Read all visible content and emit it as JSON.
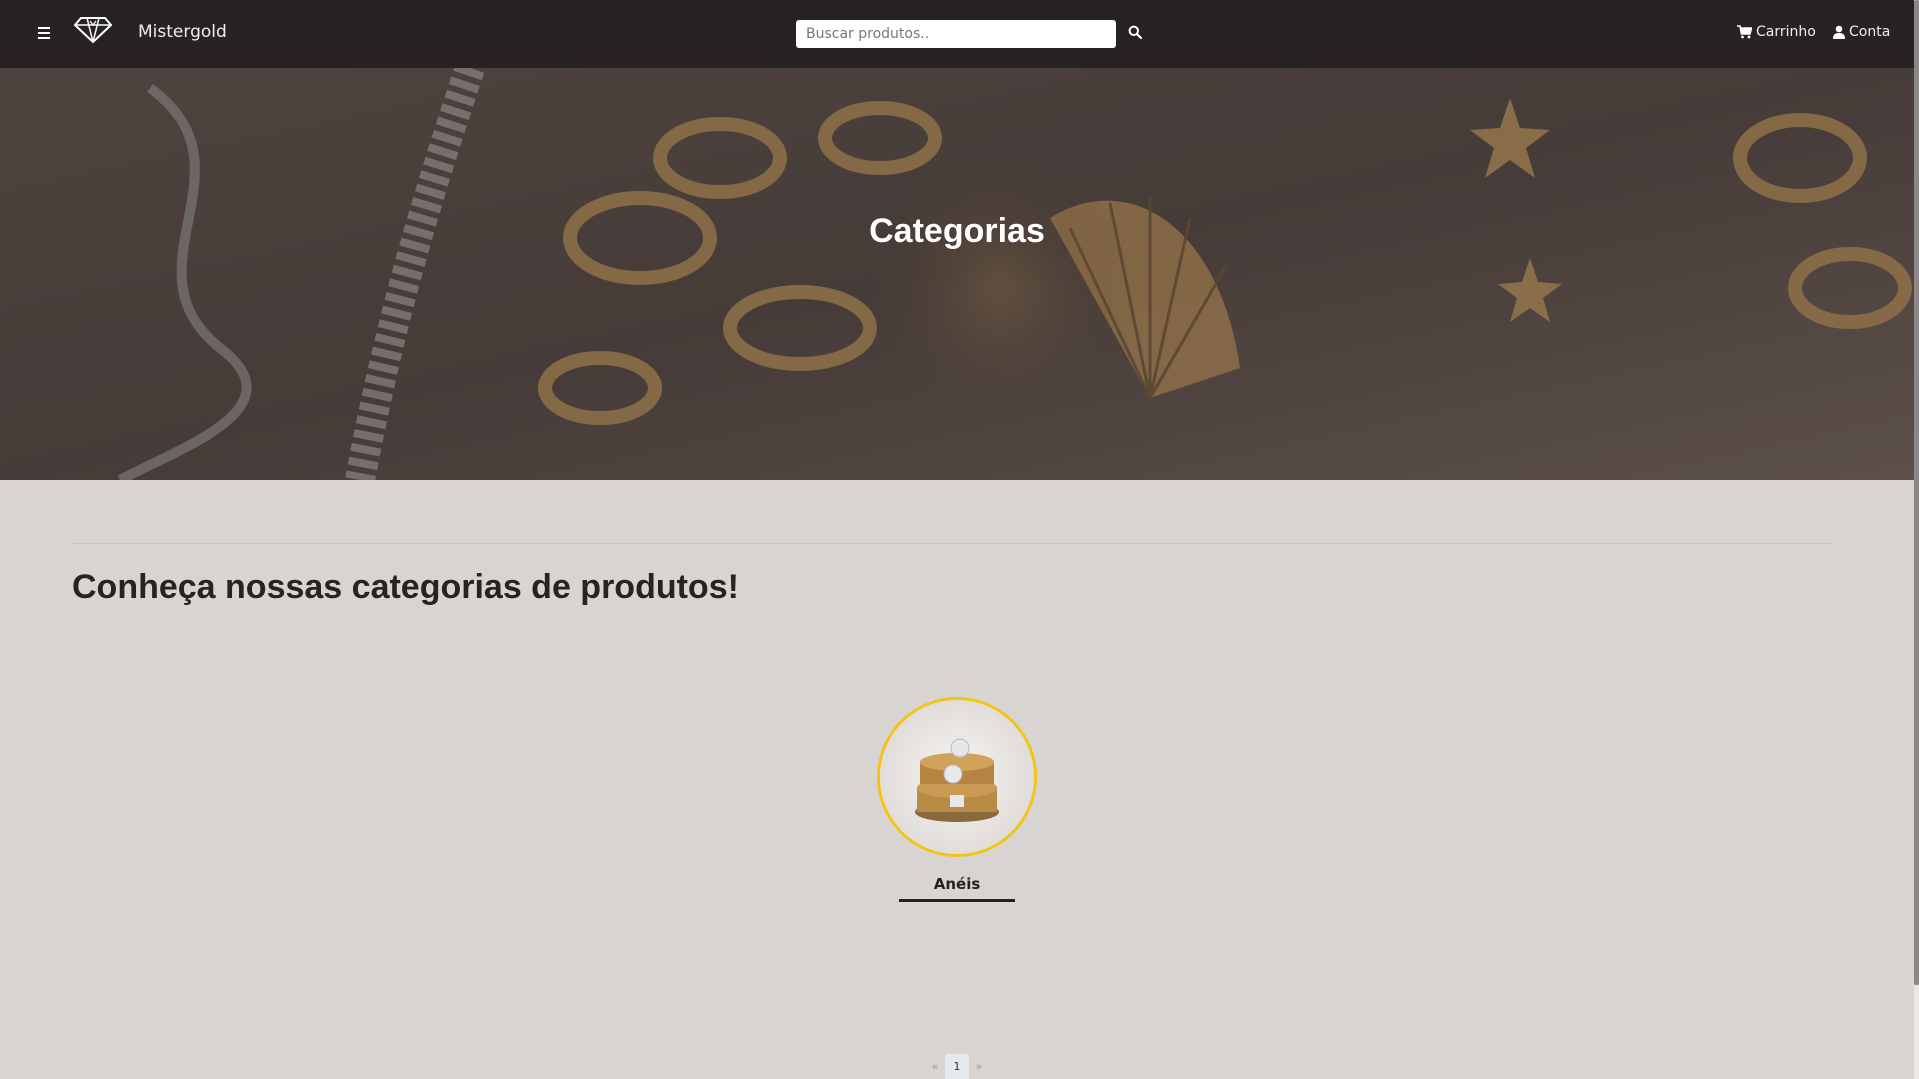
{
  "navbar": {
    "brand": "Mistergold",
    "search_placeholder": "Buscar produtos..",
    "cart_label": "Carrinho",
    "account_label": "Conta",
    "menu_icon": "hamburger-icon",
    "logo_icon": "diamond-logo",
    "search_icon": "search-icon",
    "cart_icon": "cart-icon",
    "account_icon": "user-icon"
  },
  "hero": {
    "title": "Categorias"
  },
  "main": {
    "section_title": "Conheça nossas categorias de produtos!",
    "categories": [
      {
        "label": "Anéis",
        "image": "rings-photo"
      }
    ]
  },
  "pagination": {
    "prev": "«",
    "pages": [
      "1"
    ],
    "next": "»",
    "current": "1"
  },
  "colors": {
    "navbar_bg": "#272322",
    "page_bg": "#d8d4d1",
    "accent_gold": "#f2c514"
  }
}
